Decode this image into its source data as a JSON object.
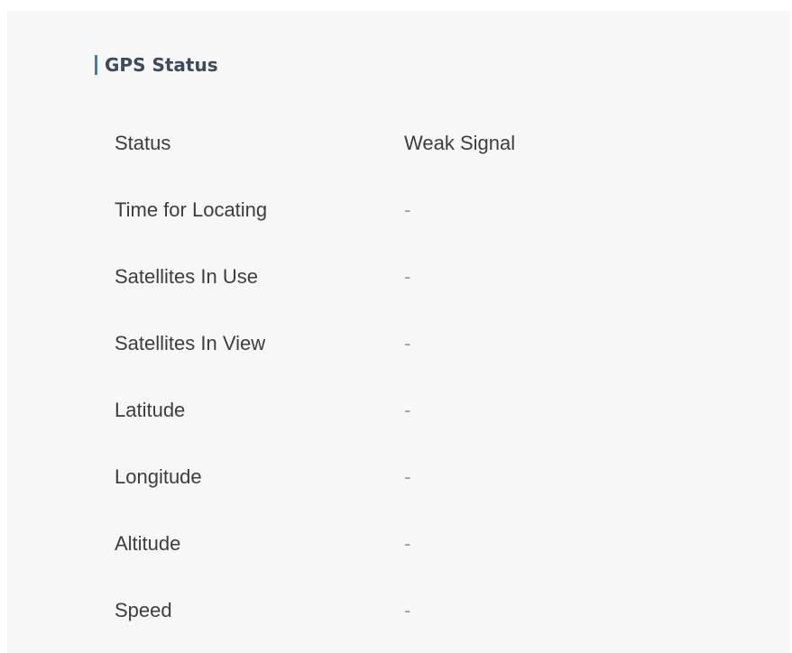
{
  "section": {
    "title": "GPS Status"
  },
  "rows": [
    {
      "label": "Status",
      "value": "Weak Signal"
    },
    {
      "label": "Time for Locating",
      "value": "-"
    },
    {
      "label": "Satellites In Use",
      "value": "-"
    },
    {
      "label": "Satellites In View",
      "value": "-"
    },
    {
      "label": "Latitude",
      "value": "-"
    },
    {
      "label": "Longitude",
      "value": "-"
    },
    {
      "label": "Altitude",
      "value": "-"
    },
    {
      "label": "Speed",
      "value": "-"
    }
  ],
  "colors": {
    "accent": "#2f80c8",
    "panel_background": "#f7f7f7",
    "text": "#3d3d3d"
  }
}
